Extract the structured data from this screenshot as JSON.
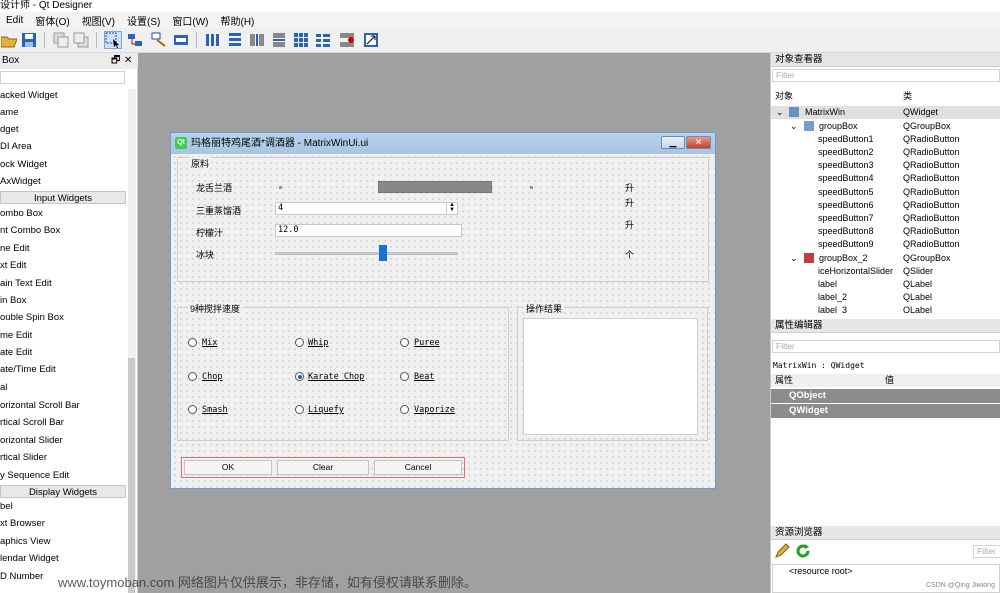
{
  "window": {
    "title": "设计师 - Qt Designer"
  },
  "menu": [
    "Edit",
    "窗体(O)",
    "视图(V)",
    "设置(S)",
    "窗口(W)",
    "帮助(H)"
  ],
  "widget_box": {
    "title": "Box",
    "items_top": [
      "acked Widget",
      "ame",
      "dget",
      "DI Area",
      "ock Widget",
      "AxWidget"
    ],
    "cat_input": "Input Widgets",
    "items_input": [
      "ombo Box",
      "nt Combo Box",
      "ne Edit",
      "xt Edit",
      "ain Text Edit",
      "in Box",
      "ouble Spin Box",
      "me Edit",
      "ate Edit",
      "ate/Time Edit",
      "al",
      "orizontal Scroll Bar",
      "rtical Scroll Bar",
      "orizontal Slider",
      "rtical Slider",
      "y Sequence Edit"
    ],
    "cat_display": "Display Widgets",
    "items_display": [
      "bel",
      "xt Browser",
      "aphics View",
      "lendar Widget",
      "D Number"
    ]
  },
  "form": {
    "title": "玛格丽特鸡尾酒*调酒器 - MatrixWinUi.ui",
    "group1_title": "原料",
    "row1_label": "龙舌兰酒",
    "row2_label": "三重蒸馏酒",
    "row2_value": "4",
    "row3_label": "柠檬汁",
    "row3_value": "12.0",
    "row4_label": "冰块",
    "units": [
      "升",
      "升",
      "升",
      "个"
    ],
    "group2_title": "9种搅拌速度",
    "speeds": [
      {
        "label": "Mix",
        "checked": false
      },
      {
        "label": "Whip",
        "checked": false
      },
      {
        "label": "Puree",
        "checked": false
      },
      {
        "label": "Chop",
        "checked": false
      },
      {
        "label": "Karate Chop",
        "checked": true
      },
      {
        "label": "Beat",
        "checked": false
      },
      {
        "label": "Smash",
        "checked": false
      },
      {
        "label": "Liquefy",
        "checked": false
      },
      {
        "label": "Vaporize",
        "checked": false
      }
    ],
    "group3_title": "操作结果",
    "ok": "OK",
    "clear": "Clear",
    "cancel": "Cancel"
  },
  "object_inspector": {
    "title": "对象查看器",
    "filter": "Filter",
    "col_object": "对象",
    "col_class": "类",
    "rows": [
      {
        "name": "MatrixWin",
        "cls": "QWidget"
      },
      {
        "name": "groupBox",
        "cls": "QGroupBox"
      },
      {
        "name": "speedButton1",
        "cls": "QRadioButton"
      },
      {
        "name": "speedButton2",
        "cls": "QRadioButton"
      },
      {
        "name": "speedButton3",
        "cls": "QRadioButton"
      },
      {
        "name": "speedButton4",
        "cls": "QRadioButton"
      },
      {
        "name": "speedButton5",
        "cls": "QRadioButton"
      },
      {
        "name": "speedButton6",
        "cls": "QRadioButton"
      },
      {
        "name": "speedButton7",
        "cls": "QRadioButton"
      },
      {
        "name": "speedButton8",
        "cls": "QRadioButton"
      },
      {
        "name": "speedButton9",
        "cls": "QRadioButton"
      },
      {
        "name": "groupBox_2",
        "cls": "QGroupBox"
      },
      {
        "name": "iceHorizontalSlider",
        "cls": "QSlider"
      },
      {
        "name": "label",
        "cls": "QLabel"
      },
      {
        "name": "label_2",
        "cls": "QLabel"
      },
      {
        "name": "label_3",
        "cls": "QLabel"
      }
    ]
  },
  "property_editor": {
    "title": "属性编辑器",
    "filter": "Filter",
    "context": "MatrixWin : QWidget",
    "col_prop": "属性",
    "col_value": "值",
    "sections": [
      "QObject",
      "QWidget"
    ]
  },
  "resource_browser": {
    "title": "资源浏览器",
    "filter": "Filter",
    "root": "<resource root>"
  },
  "watermark": "www.toymoban.com 网络图片仅供展示，非存储，如有侵权请联系删除。",
  "credit": "CSDN @Qing Jiwiong"
}
